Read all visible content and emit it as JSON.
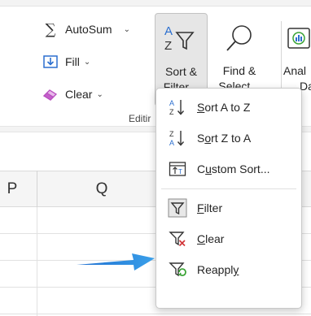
{
  "ribbon": {
    "autosum_label": "AutoSum",
    "fill_label": "Fill",
    "clear_label": "Clear",
    "sort_filter_line1": "Sort &",
    "sort_filter_line2": "Filter",
    "find_select_line1": "Find &",
    "find_select_line2": "Select",
    "analyze_line1": "Anal",
    "analyze_line2": "Da",
    "group_label": "Editir"
  },
  "sheet": {
    "columns": [
      "P",
      "Q"
    ]
  },
  "menu": {
    "items": [
      {
        "pre": "",
        "ul": "S",
        "post": "ort A to Z",
        "icon": "sort-az-icon"
      },
      {
        "pre": "S",
        "ul": "o",
        "post": "rt Z to A",
        "icon": "sort-za-icon"
      },
      {
        "pre": "C",
        "ul": "u",
        "post": "stom Sort...",
        "icon": "custom-sort-icon"
      },
      {
        "pre": "",
        "ul": "F",
        "post": "ilter",
        "icon": "filter-icon"
      },
      {
        "pre": "",
        "ul": "C",
        "post": "lear",
        "icon": "clear-filter-icon"
      },
      {
        "pre": "Reappl",
        "ul": "y",
        "post": "",
        "icon": "reapply-icon"
      }
    ]
  },
  "colors": {
    "accent_blue": "#2b6fcf",
    "arrow_blue": "#2e86de",
    "clear_red": "#d13438",
    "reapply_green": "#3aa335"
  }
}
